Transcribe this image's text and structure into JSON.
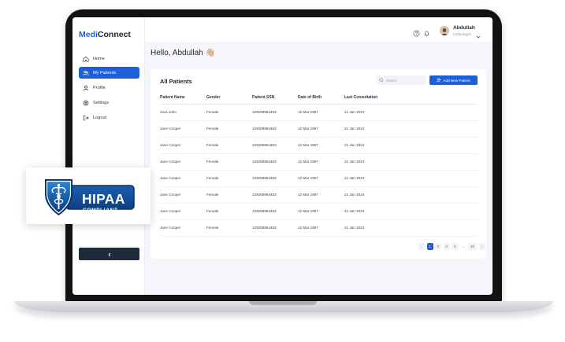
{
  "app": {
    "logo_part1": "Medi",
    "logo_part2": "Connect",
    "accent_color": "#1e5fd8"
  },
  "sidebar": {
    "items": [
      {
        "label": "Home",
        "icon": "home-icon",
        "active": false
      },
      {
        "label": "My Patients",
        "icon": "users-icon",
        "active": true
      },
      {
        "label": "Profile",
        "icon": "user-icon",
        "active": false
      },
      {
        "label": "Settings",
        "icon": "gear-icon",
        "active": false
      },
      {
        "label": "Logout",
        "icon": "logout-icon",
        "active": false
      }
    ],
    "collapse_icon": "chevron-left-icon"
  },
  "header": {
    "icons": [
      "help-icon",
      "bell-icon"
    ],
    "user_name": "Abdullah",
    "user_role": "Cardiologist"
  },
  "greeting": {
    "text": "Hello, Abdullah",
    "emoji": "👋🏼"
  },
  "patients": {
    "title": "All Patients",
    "search_placeholder": "Search",
    "add_button": "Add New Patient",
    "columns": [
      "Patient Name",
      "Gender",
      "Patient SSN",
      "Date of Birth",
      "Last Consultation"
    ],
    "rows": [
      [
        "Sara John",
        "Female",
        "129259964463",
        "12 Mar 1997",
        "21 Jan 2024"
      ],
      [
        "Jane Cooper",
        "Female",
        "129259964463",
        "12 Mar 1997",
        "21 Jan 2024"
      ],
      [
        "Jane Cooper",
        "Female",
        "129259964463",
        "12 Mar 1997",
        "21 Jan 2024"
      ],
      [
        "Jane Cooper",
        "Female",
        "129259964463",
        "12 Mar 1997",
        "21 Jan 2024"
      ],
      [
        "Jane Cooper",
        "Female",
        "129259964463",
        "12 Mar 1997",
        "21 Jan 2024"
      ],
      [
        "Jane Cooper",
        "Female",
        "129259964463",
        "12 Mar 1997",
        "21 Jan 2024"
      ],
      [
        "Jane Cooper",
        "Female",
        "129259964463",
        "12 Mar 1997",
        "21 Jan 2024"
      ],
      [
        "Jane Cooper",
        "Female",
        "129259964463",
        "12 Mar 1997",
        "21 Jan 2024"
      ]
    ],
    "pagination": {
      "prev": "‹",
      "pages": [
        "1",
        "2",
        "3",
        "4",
        "...",
        "10"
      ],
      "current": "1",
      "next": "›"
    }
  },
  "badge": {
    "line1": "HIPAA",
    "line2": "COMPLIANT",
    "icon": "caduceus-shield-icon"
  }
}
